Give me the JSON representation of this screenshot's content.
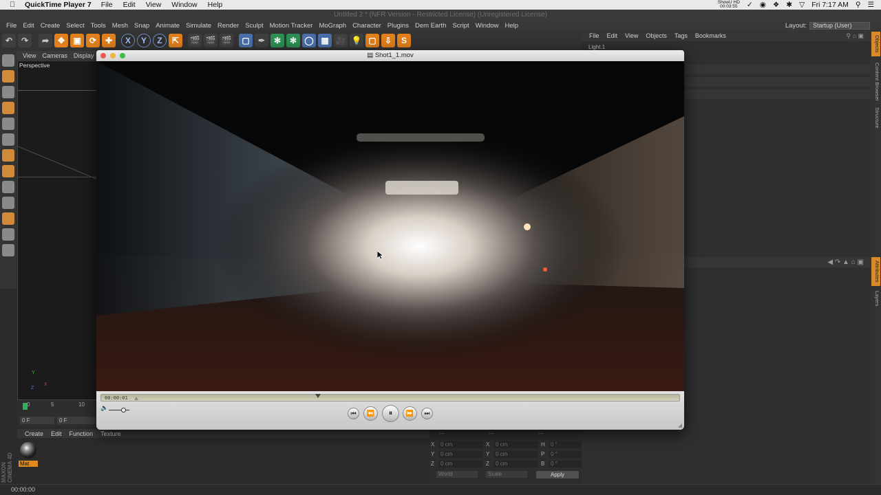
{
  "mac_menubar": {
    "apple_icon": "apple-logo-icon",
    "app_name": "QuickTime Player 7",
    "items": [
      "File",
      "Edit",
      "View",
      "Window",
      "Help"
    ],
    "showup_label": "ShowU HD",
    "showup_time": "00:03:55",
    "clock": "Fri 7:17 AM"
  },
  "c4d": {
    "window_title": "Untitled 2 * (NFR Version - Restricted License) (Unregistered License)",
    "menu": [
      "File",
      "Edit",
      "Create",
      "Select",
      "Tools",
      "Mesh",
      "Snap",
      "Animate",
      "Simulate",
      "Render",
      "Sculpt",
      "Motion Tracker",
      "MoGraph",
      "Character",
      "Plugins",
      "Dem Earth",
      "Script",
      "Window",
      "Help"
    ],
    "layout_label": "Layout:",
    "layout_value": "Startup (User)",
    "toolbar": {
      "x": "X",
      "y": "Y",
      "z": "Z",
      "s": "S"
    },
    "viewport_menu": [
      "View",
      "Cameras",
      "Display"
    ],
    "viewport_label": "Perspective",
    "axis": {
      "x": "X",
      "y": "Y",
      "z": "Z"
    },
    "timeline_ticks": [
      "0",
      "5",
      "10"
    ],
    "timeline_frame_start": "0 F",
    "timeline_frame_field": "0 F",
    "material_menu": [
      "Create",
      "Edit",
      "Function",
      "Texture"
    ],
    "material_name": "Mat",
    "maxon_logo": "MAXON CINEMA 4D",
    "coords": {
      "header": [
        "---",
        "---",
        "---"
      ],
      "rows": [
        {
          "a": "X",
          "av": "0 cm",
          "b": "X",
          "bv": "0 cm",
          "c": "H",
          "cv": "0 °"
        },
        {
          "a": "Y",
          "av": "0 cm",
          "b": "Y",
          "bv": "0 cm",
          "c": "P",
          "cv": "0 °"
        },
        {
          "a": "Z",
          "av": "0 cm",
          "b": "Z",
          "bv": "0 cm",
          "c": "B",
          "cv": "0 °"
        }
      ],
      "world_dropdown": "World",
      "scale_dropdown": "Scale",
      "apply": "Apply"
    },
    "object_menu": [
      "File",
      "Edit",
      "View",
      "Objects",
      "Tags",
      "Bookmarks"
    ],
    "object_row": "Light.1",
    "side_tabs": [
      "Objects",
      "Content Browser",
      "Structure",
      "Attributes",
      "Layers"
    ],
    "status_time": "00:00:00"
  },
  "quicktime": {
    "title": "Shot1_1.mov",
    "timecode": "00:00:01",
    "progress_fraction": 0.37,
    "volume_fraction": 0.6,
    "buttons": {
      "start": "⏮",
      "rewind": "⏪",
      "pause": "⏸",
      "forward": "⏩",
      "end": "⏭"
    }
  }
}
